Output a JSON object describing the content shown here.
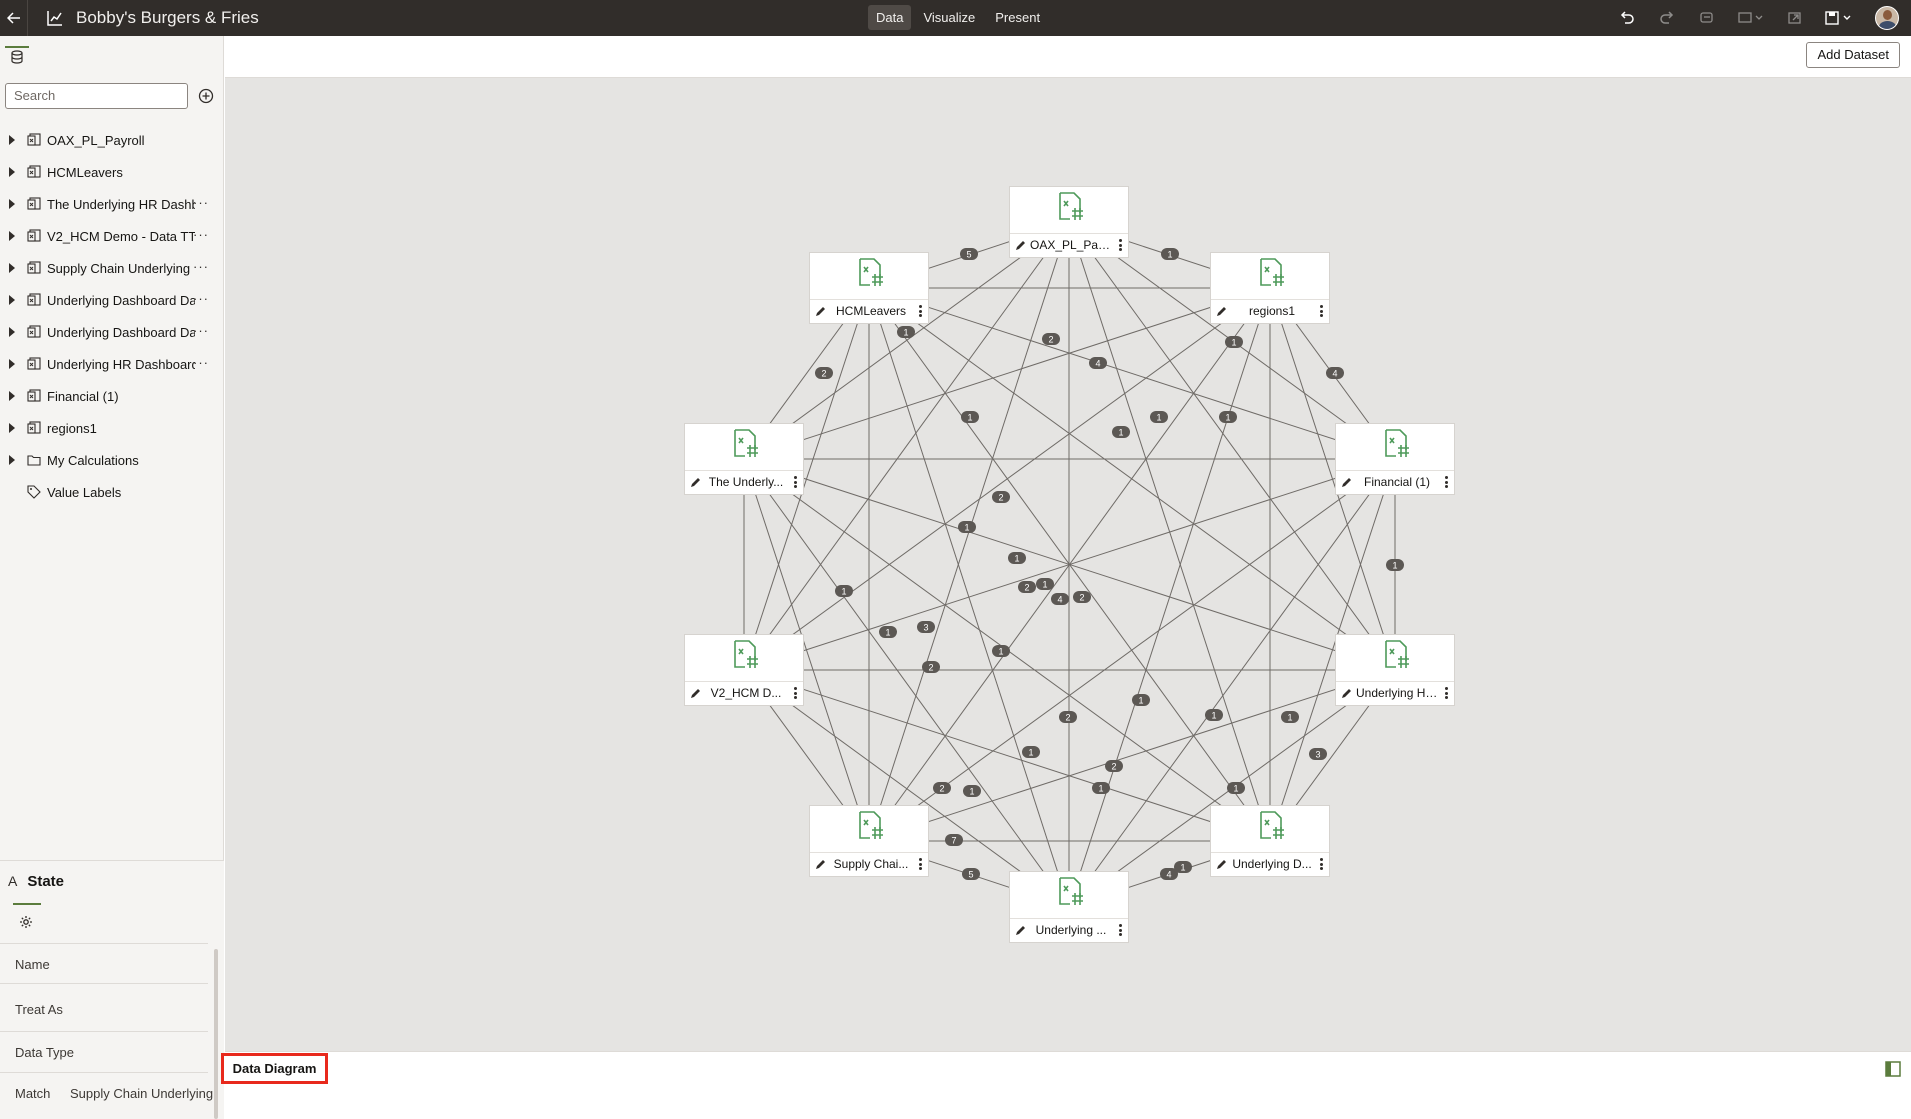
{
  "app": {
    "title": "Bobby's Burgers & Fries",
    "modes": [
      "Data",
      "Visualize",
      "Present"
    ],
    "active_mode": "Data"
  },
  "toolbar": {
    "add_dataset_label": "Add Dataset"
  },
  "left_panel": {
    "search_placeholder": "Search",
    "tree": [
      {
        "label": "OAX_PL_Payroll",
        "icon": "dataset-icon",
        "more": false
      },
      {
        "label": "HCMLeavers",
        "icon": "dataset-icon",
        "more": false
      },
      {
        "label": "The Underlying HR Dashb",
        "icon": "dataset-icon",
        "more": true
      },
      {
        "label": "V2_HCM Demo - Data TT",
        "icon": "dataset-icon",
        "more": true
      },
      {
        "label": "Supply Chain Underlying",
        "icon": "dataset-icon",
        "more": true
      },
      {
        "label": "Underlying Dashboard Da",
        "icon": "dataset-icon",
        "more": true
      },
      {
        "label": "Underlying Dashboard Da",
        "icon": "dataset-icon",
        "more": true
      },
      {
        "label": "Underlying HR Dashboard",
        "icon": "dataset-icon",
        "more": true
      },
      {
        "label": "Financial (1)",
        "icon": "dataset-icon",
        "more": false
      },
      {
        "label": "regions1",
        "icon": "dataset-icon",
        "more": false
      },
      {
        "label": "My Calculations",
        "icon": "folder-icon",
        "more": false
      },
      {
        "label": "Value Labels",
        "icon": "tag-icon",
        "more": false,
        "no_caret": true
      }
    ]
  },
  "properties": {
    "title": "State",
    "type_glyph": "A",
    "rows": [
      {
        "label": "Name",
        "value": ""
      },
      {
        "label": "Treat As",
        "value": ""
      },
      {
        "label": "Data Type",
        "value": ""
      },
      {
        "label": "Match",
        "value": "Supply Chain Underlying"
      }
    ]
  },
  "diagram": {
    "nodes": [
      {
        "id": "oax",
        "label": "OAX_PL_Payr..."
      },
      {
        "id": "regions",
        "label": "regions1"
      },
      {
        "id": "financial",
        "label": "Financial (1)"
      },
      {
        "id": "uhr",
        "label": "Underlying HR..."
      },
      {
        "id": "udash1",
        "label": "Underlying D..."
      },
      {
        "id": "udash2",
        "label": "Underlying ..."
      },
      {
        "id": "supply",
        "label": "Supply Chai..."
      },
      {
        "id": "v2hcm",
        "label": "V2_HCM D..."
      },
      {
        "id": "theund",
        "label": "The Underly..."
      },
      {
        "id": "hcm",
        "label": "HCMLeavers"
      }
    ],
    "badges": [
      "5",
      "1",
      "2",
      "4",
      "4",
      "1",
      "1",
      "2",
      "1",
      "2",
      "1",
      "1",
      "1",
      "1",
      "1",
      "1",
      "2",
      "1",
      "1",
      "4",
      "2",
      "3",
      "1",
      "1",
      "2",
      "1",
      "1",
      "1",
      "3",
      "2",
      "2",
      "1",
      "1",
      "1",
      "2",
      "2",
      "1",
      "1",
      "1",
      "2",
      "7",
      "5",
      "4"
    ]
  },
  "bottom": {
    "tabs": [
      "Data Diagram"
    ]
  }
}
